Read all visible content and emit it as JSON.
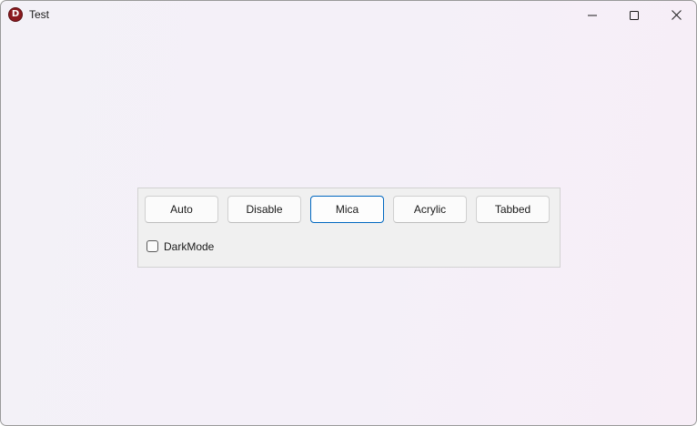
{
  "window": {
    "title": "Test",
    "app_icon_letter": "D"
  },
  "controls": {
    "minimize_icon": "minimize-icon",
    "maximize_icon": "maximize-icon",
    "close_icon": "close-icon"
  },
  "buttons": [
    {
      "label": "Auto"
    },
    {
      "label": "Disable"
    },
    {
      "label": "Mica",
      "focused": true
    },
    {
      "label": "Acrylic"
    },
    {
      "label": "Tabbed"
    }
  ],
  "darkmode": {
    "label": "DarkMode",
    "checked": false
  },
  "colors": {
    "focus_border": "#0067c0",
    "app_icon": "#8b1a1f"
  }
}
